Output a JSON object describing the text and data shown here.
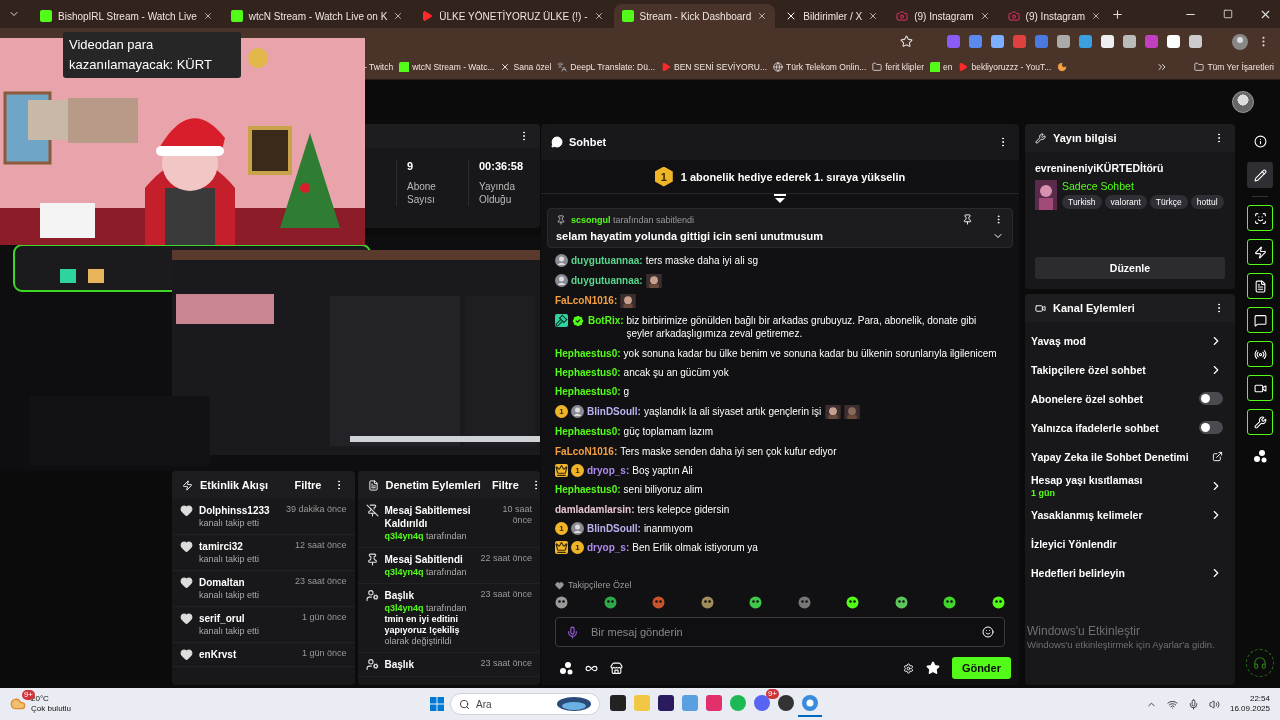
{
  "browser": {
    "tabs": [
      {
        "kind": "kick",
        "label": "BishopIRL Stream - Watch Live",
        "selected": false
      },
      {
        "kind": "kick",
        "label": "wtcN Stream - Watch Live on K",
        "selected": false
      },
      {
        "kind": "youtube",
        "label": "ÜLKE YÖNETİYORUZ ÜLKE (!) -",
        "selected": false
      },
      {
        "kind": "kick",
        "label": "Stream - Kick Dashboard",
        "selected": true
      },
      {
        "kind": "x",
        "label": "Bildirimler / X",
        "selected": false
      },
      {
        "kind": "instagram",
        "label": "(9) Instagram",
        "selected": false
      },
      {
        "kind": "instagram",
        "label": "(9) Instagram",
        "selected": false
      }
    ],
    "bookmarks": [
      {
        "kind": "plain",
        "label": "- Twitch"
      },
      {
        "kind": "kick",
        "label": "wtcN Stream - Watc..."
      },
      {
        "kind": "x",
        "label": "Sana özel"
      },
      {
        "kind": "deepl",
        "label": "DeepL Translate: Dü..."
      },
      {
        "kind": "youtube",
        "label": "BEN SENİ SEVİYORU..."
      },
      {
        "kind": "globe",
        "label": "Türk Telekom Onlin..."
      },
      {
        "kind": "folder",
        "label": "ferit klipler"
      },
      {
        "kind": "kick",
        "label": "en"
      },
      {
        "kind": "youtube",
        "label": "bekliyoruzzz - YouT..."
      },
      {
        "kind": "moon"
      }
    ],
    "all_bookmarks": "Tüm Yer İşaretleri"
  },
  "video_popup": {
    "kind": "picture",
    "caption": "Videodan para kazanılamayacak: KÜRT"
  },
  "stats": [
    {
      "value": "9",
      "label": "Abone Sayısı"
    },
    {
      "value": "00:36:58",
      "label": "Yayında Olduğu"
    }
  ],
  "stream_preview": {
    "kind": "picture"
  },
  "activity_feed": {
    "title": "Etkinlik Akışı",
    "filter": "Filtre",
    "items": [
      {
        "user": "Dolphinss1233",
        "action": "kanalı takip etti",
        "time": "39 dakika önce"
      },
      {
        "user": "tamirci32",
        "action": "kanalı takip etti",
        "time": "12 saat önce"
      },
      {
        "user": "Domaltan",
        "action": "kanalı takip etti",
        "time": "23 saat önce"
      },
      {
        "user": "serif_orul",
        "action": "kanalı takip etti",
        "time": "1 gün önce"
      },
      {
        "user": "enKrvst",
        "time": "1 gün önce"
      }
    ]
  },
  "moderation": {
    "title": "Denetim Eylemleri",
    "filter": "Filtre",
    "items": [
      {
        "kind": "unpin",
        "title": "Mesaj Sabitlemesi Kaldırıldı",
        "time": "10 saat önce",
        "by": "q3l4yn4q",
        "detail": "tarafından"
      },
      {
        "kind": "pin",
        "title": "Mesaj Sabitlendi",
        "time": "22 saat önce",
        "by": "q3l4yn4q",
        "detail": "tarafından"
      },
      {
        "kind": "title",
        "title": "Başlık",
        "time": "23 saat önce",
        "by": "q3l4yn4q",
        "detail": "tarafından **tmin en iyi editini yapıyoruz !çekiliş** olarak değiştirildi"
      },
      {
        "kind": "title",
        "title": "Başlık",
        "time": "23 saat önce"
      }
    ]
  },
  "chat": {
    "title": "Sohbet",
    "goal": {
      "rank": "1",
      "text": "1 abonelik hediye ederek 1. sıraya yükselin"
    },
    "pinned": {
      "by": "scsongul",
      "by_text": "tarafından sabitlendi",
      "text": "selam hayatim yolunda gittigi icin seni unutmusum"
    },
    "messages": [
      {
        "user": "duygutuannaa:",
        "color": "#58d68d",
        "badges": [
          {
            "kind": "avatar"
          }
        ],
        "text": "ters maske daha iyi ali sg"
      },
      {
        "user": "duygutuannaa:",
        "color": "#58d68d",
        "badges": [
          {
            "kind": "avatar"
          }
        ],
        "emotes": [
          {
            "kind": "picture"
          }
        ]
      },
      {
        "user": "FaLcoN1016:",
        "color": "#f5a142",
        "emotes": [
          {
            "kind": "picture"
          }
        ]
      },
      {
        "user": "BotRix:",
        "color": "#53fc18",
        "badges": [
          {
            "kind": "mod"
          },
          {
            "kind": "verified"
          }
        ],
        "text": "biz birbirimize gönülden bağlı bir arkadas grubuyuz. Para, abonelik, donate gibi şeyler arkadaşlıgımıza zeval getiremez."
      },
      {
        "user": "Hephaestus0:",
        "color": "#53fc18",
        "text": "yok sonuna kadar bu ülke benim ve sonuna kadar bu ülkenin sorunlarıyla ilgilenicem"
      },
      {
        "user": "Hephaestus0:",
        "color": "#53fc18",
        "text": "ancak şu an gücüm yok"
      },
      {
        "user": "Hephaestus0:",
        "color": "#53fc18",
        "text": "g"
      },
      {
        "user": "BlinDSoull:",
        "color": "#b9b4f0",
        "badges": [
          {
            "kind": "sub",
            "label": "1"
          },
          {
            "kind": "avatar"
          }
        ],
        "text": "yaşlandık la ali siyaset artık gençlerin işi",
        "emotes": [
          {
            "kind": "picture"
          },
          {
            "kind": "picture"
          }
        ]
      },
      {
        "user": "Hephaestus0:",
        "color": "#53fc18",
        "text": "güç toplamam lazım"
      },
      {
        "user": "FaLcoN1016:",
        "color": "#f5a142",
        "text": "Ters maske senden daha iyi sen çok kufur ediyor"
      },
      {
        "user": "dryop_s:",
        "color": "#b08cf0",
        "badges": [
          {
            "kind": "crown"
          },
          {
            "kind": "sub",
            "label": "1"
          }
        ],
        "text": "Boş yaptın Ali"
      },
      {
        "user": "Hephaestus0:",
        "color": "#53fc18",
        "text": "seni biliyoruz alim"
      },
      {
        "user": "damladamlarsin:",
        "color": "#e8c4d4",
        "text": "ters kelepce gidersin"
      },
      {
        "user": "BlinDSoull:",
        "color": "#b9b4f0",
        "badges": [
          {
            "kind": "sub",
            "label": "1"
          },
          {
            "kind": "avatar"
          }
        ],
        "text": "inanmıyom"
      },
      {
        "user": "dryop_s:",
        "color": "#b08cf0",
        "badges": [
          {
            "kind": "crown"
          },
          {
            "kind": "sub",
            "label": "1"
          }
        ],
        "text": "Ben Erlik olmak istiyorum ya"
      }
    ],
    "followers_only": "Takipçilere Özel",
    "input_placeholder": "Bir mesaj gönderin",
    "send": "Gönder"
  },
  "stream_info": {
    "title": "Yayın bilgisi",
    "stream_title": "evrenineniyiKÜRTEDİtörü",
    "category": "Sadece Sohbet",
    "tags": [
      "Turkish",
      "valorant",
      "Türkçe",
      "hottul"
    ],
    "edit": "Düzenle"
  },
  "channel_actions": {
    "title": "Kanal Eylemleri",
    "items": [
      {
        "kind": "link",
        "label": "Yavaş mod"
      },
      {
        "kind": "link",
        "label": "Takipçilere özel sohbet"
      },
      {
        "kind": "toggle",
        "label": "Abonelere özel sohbet",
        "on": false
      },
      {
        "kind": "toggle",
        "label": "Yalnızca ifadelerle sohbet",
        "on": false
      },
      {
        "kind": "external",
        "label": "Yapay Zeka ile Sohbet Denetimi"
      },
      {
        "kind": "link",
        "label": "Hesap yaşı kısıtlaması",
        "value": "1 gün"
      },
      {
        "kind": "link",
        "label": "Yasaklanmış kelimeler"
      },
      {
        "kind": "plain",
        "label": "İzleyici Yönlendir"
      },
      {
        "kind": "link",
        "label": "Hedefleri belirleyin"
      }
    ]
  },
  "rail": [
    {
      "kind": "info",
      "selected": false,
      "on": false
    },
    {
      "kind": "edit",
      "selected": true,
      "on": false
    },
    {
      "kind": "scan",
      "selected": false,
      "on": true
    },
    {
      "kind": "zap",
      "selected": false,
      "on": true
    },
    {
      "kind": "doc",
      "selected": false,
      "on": true
    },
    {
      "kind": "chat",
      "selected": false,
      "on": true
    },
    {
      "kind": "broadcast",
      "selected": false,
      "on": true
    },
    {
      "kind": "video",
      "selected": false,
      "on": true
    },
    {
      "kind": "wrench",
      "selected": false,
      "on": true
    },
    {
      "kind": "dots",
      "selected": false,
      "on": false
    }
  ],
  "windows_notice": {
    "title": "Windows'u Etkinleştir",
    "text": "Windows'u etkinleştirmek için Ayarlar'a gidin."
  },
  "taskbar": {
    "weather": {
      "temp": "20°C",
      "desc": "Çok bulutlu",
      "badge": "9+"
    },
    "search": "Ara",
    "apps": [
      {
        "kind": "taskview"
      },
      {
        "kind": "folder"
      },
      {
        "kind": "premiere"
      },
      {
        "kind": "gear"
      },
      {
        "kind": "insta"
      },
      {
        "kind": "spotify"
      },
      {
        "kind": "discord",
        "badge": "9+"
      },
      {
        "kind": "dark"
      },
      {
        "kind": "chrome",
        "selected": true
      }
    ],
    "time": "22:54",
    "date": "16.09.2025"
  }
}
